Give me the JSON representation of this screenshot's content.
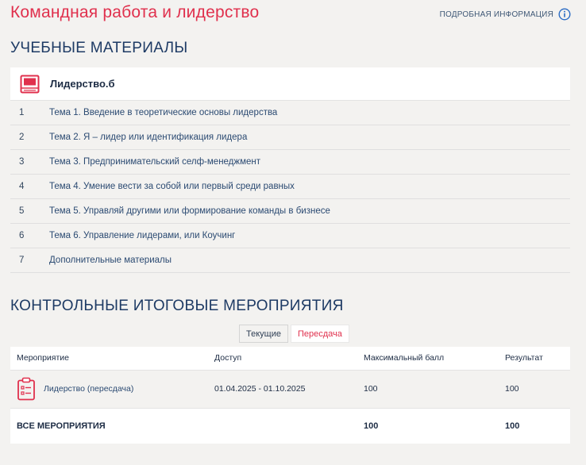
{
  "header": {
    "title": "Командная работа и лидерство",
    "info_label": "ПОДРОБНАЯ ИНФОРМАЦИЯ",
    "info_icon": "info-circle-icon"
  },
  "materials": {
    "section_title": "УЧЕБНЫЕ МАТЕРИАЛЫ",
    "course": {
      "icon": "book-icon",
      "title": "Лидерство.б"
    },
    "topics": [
      {
        "num": "1",
        "title": "Тема 1. Введение в теоретические основы лидерства"
      },
      {
        "num": "2",
        "title": "Тема 2. Я – лидер или идентификация лидера"
      },
      {
        "num": "3",
        "title": "Тема 3. Предпринимательский селф-менеджмент"
      },
      {
        "num": "4",
        "title": "Тема 4. Умение вести за собой или первый среди равных"
      },
      {
        "num": "5",
        "title": "Тема 5. Управляй другими или формирование команды в бизнесе"
      },
      {
        "num": "6",
        "title": "Тема 6. Управление лидерами, или Коучинг"
      },
      {
        "num": "7",
        "title": "Дополнительные материалы"
      }
    ]
  },
  "events": {
    "section_title": "КОНТРОЛЬНЫЕ ИТОГОВЫЕ МЕРОПРИЯТИЯ",
    "tabs": [
      {
        "label": "Текущие",
        "active": false
      },
      {
        "label": "Пересдача",
        "active": true
      }
    ],
    "columns": {
      "event": "Мероприятие",
      "access": "Доступ",
      "max": "Максимальный балл",
      "result": "Результат"
    },
    "rows": [
      {
        "icon": "clipboard-icon",
        "name": "Лидерство (пересдача)",
        "access": "01.04.2025 - 01.10.2025",
        "max": "100",
        "result": "100"
      }
    ],
    "total": {
      "label": "ВСЕ МЕРОПРИЯТИЯ",
      "max": "100",
      "result": "100"
    }
  },
  "colors": {
    "accent": "#e0304d",
    "navy": "#1d3a64",
    "background": "#f3f2f0"
  }
}
